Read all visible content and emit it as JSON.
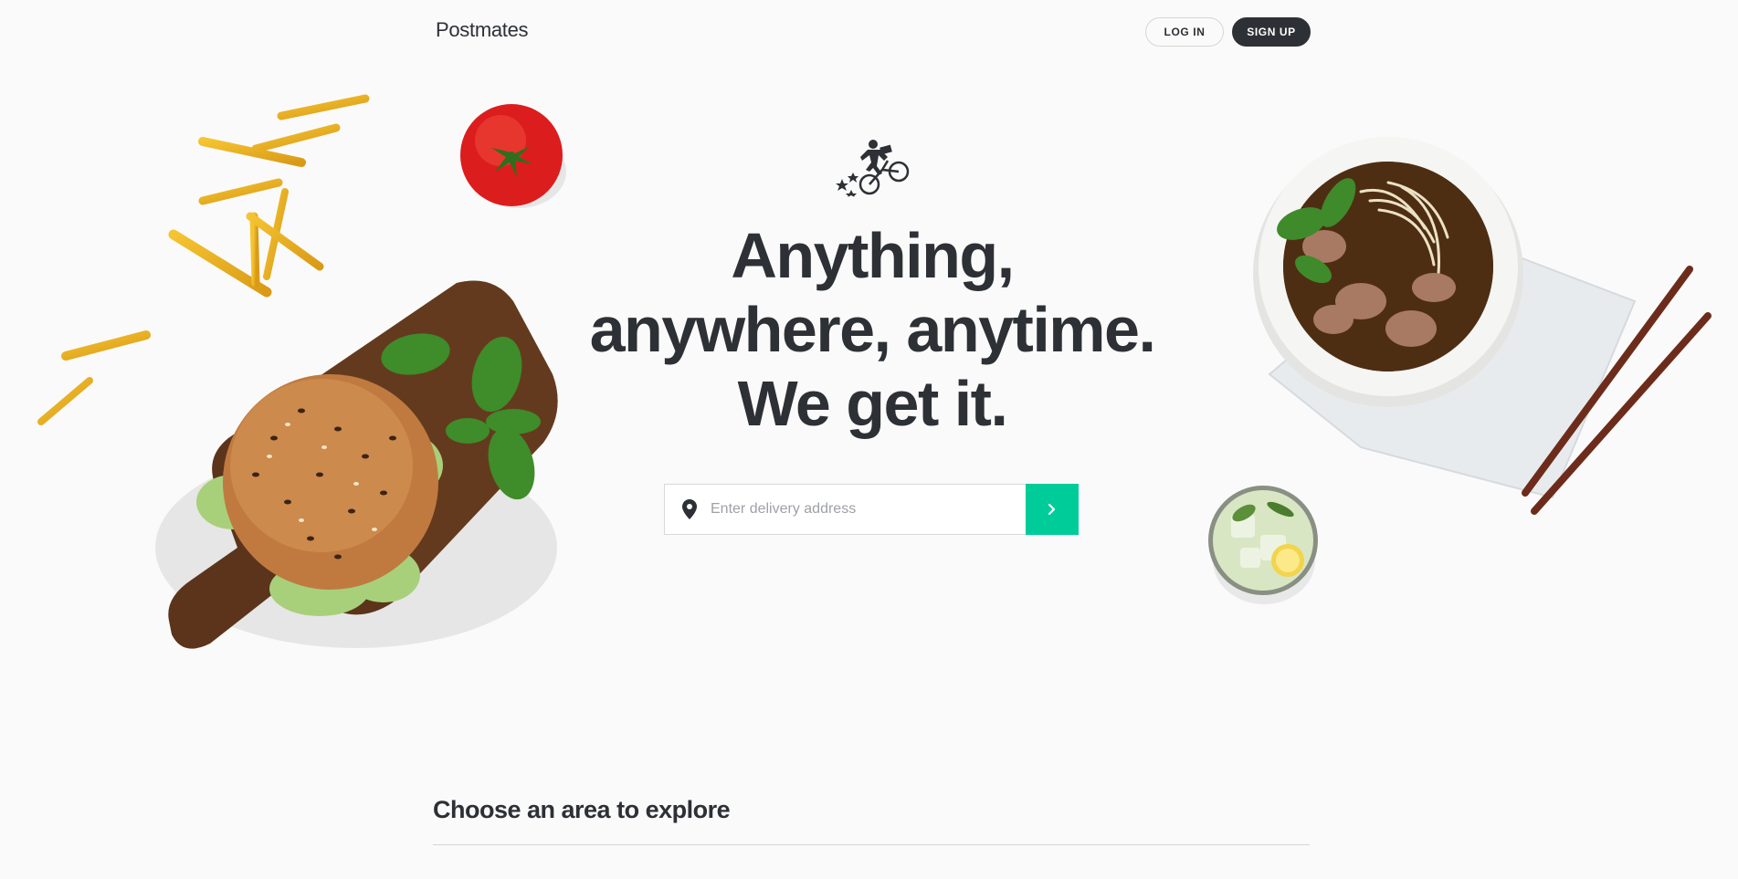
{
  "header": {
    "logo": "Postmates",
    "login_label": "LOG IN",
    "signup_label": "SIGN UP"
  },
  "hero": {
    "headline": [
      "Anything,",
      "anywhere, anytime.",
      "We get it."
    ],
    "search_placeholder": "Enter delivery address",
    "search_value": ""
  },
  "explore": {
    "title": "Choose an area to explore"
  },
  "icons": {
    "brand": "courier-bike-icon",
    "location": "location-pin-icon",
    "submit": "chevron-right-icon"
  },
  "colors": {
    "text": "#2d3035",
    "accent": "#00cc99",
    "background": "#fafafa",
    "signup_bg": "#2d3035"
  }
}
